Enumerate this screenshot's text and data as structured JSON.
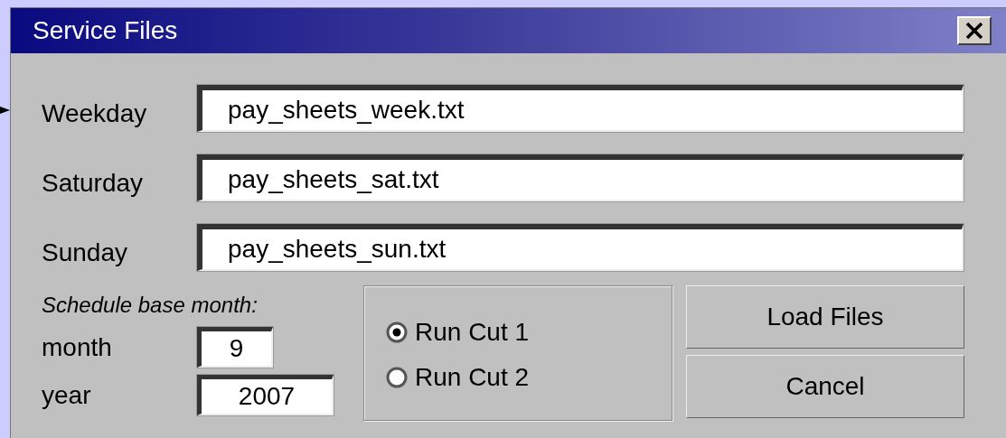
{
  "window": {
    "title": "Service Files"
  },
  "files": [
    {
      "label": "Weekday",
      "value": "pay_sheets_week.txt"
    },
    {
      "label": "Saturday",
      "value": "pay_sheets_sat.txt"
    },
    {
      "label": "Sunday",
      "value": "pay_sheets_sun.txt"
    }
  ],
  "schedule": {
    "heading": "Schedule base month:",
    "fields": [
      {
        "label": "month",
        "value": "9"
      },
      {
        "label": "year",
        "value": "2007"
      }
    ]
  },
  "run_cuts": [
    {
      "label": "Run Cut 1",
      "selected": true
    },
    {
      "label": "Run Cut 2",
      "selected": false
    }
  ],
  "buttons": [
    "Load Files",
    "Cancel"
  ]
}
